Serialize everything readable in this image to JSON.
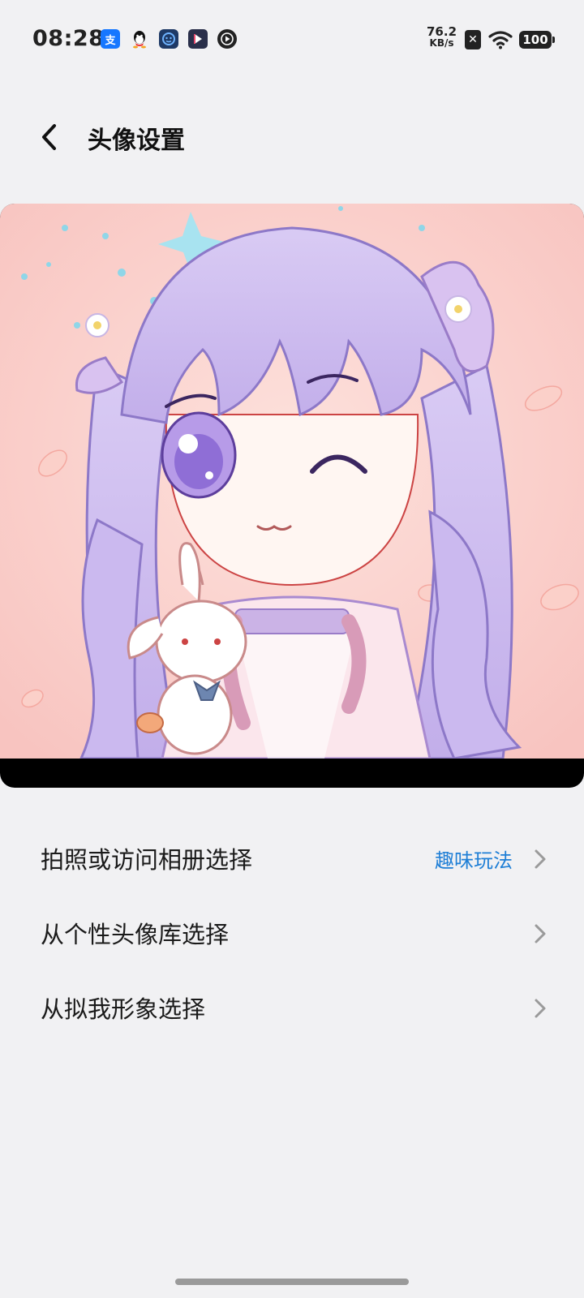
{
  "status_bar": {
    "time": "08:28",
    "notification_icons": [
      "alipay-icon",
      "qq-icon",
      "robot-app-icon",
      "video-app-icon",
      "play-app-icon"
    ],
    "alipay_glyph": "支",
    "network_speed_value": "76.2",
    "network_speed_unit": "KB/s",
    "sim_glyph": "✕",
    "battery_level": "100"
  },
  "header": {
    "back_icon": "chevron-left-icon",
    "title": "头像设置"
  },
  "avatar": {
    "description_icon": "avatar-image",
    "bg_color": "#fbd3cf",
    "hair_color": "#c9b7ec"
  },
  "options": [
    {
      "label": "拍照或访问相册选择",
      "extra": "趣味玩法"
    },
    {
      "label": "从个性头像库选择",
      "extra": ""
    },
    {
      "label": "从拟我形象选择",
      "extra": ""
    }
  ],
  "colors": {
    "background": "#f1f1f3",
    "accent_link": "#1f7fd6",
    "chevron": "#9a9a9a"
  }
}
